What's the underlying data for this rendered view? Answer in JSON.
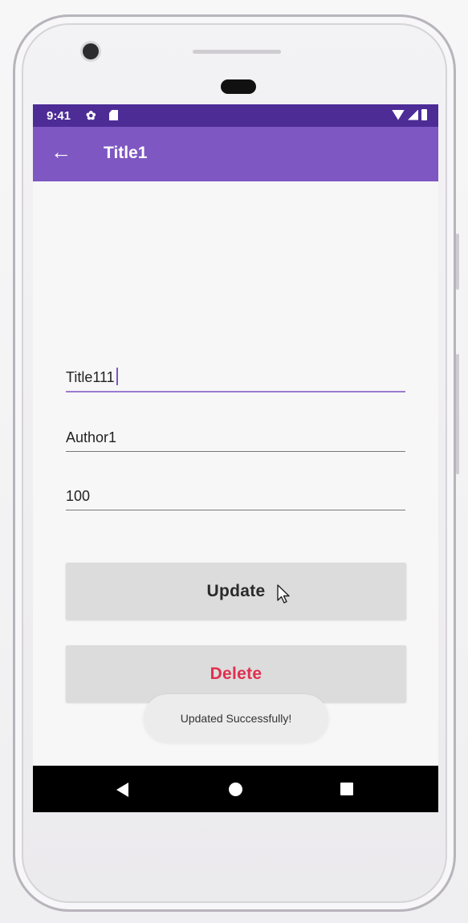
{
  "status_bar": {
    "time": "9:41",
    "icons": [
      "gear-icon",
      "sd-card-icon",
      "wifi-icon",
      "signal-icon",
      "battery-icon"
    ]
  },
  "app_bar": {
    "title": "Title1",
    "back_icon": "arrow-left-icon",
    "background": "#7e57c2",
    "status_background": "#4d2c96"
  },
  "form": {
    "title_value": "Title111",
    "author_value": "Author1",
    "price_value": "100"
  },
  "buttons": {
    "update_label": "Update",
    "delete_label": "Delete",
    "delete_color": "#e0304f"
  },
  "toast": {
    "message": "Updated Successfully!"
  },
  "nav": {
    "icons": [
      "nav-back-icon",
      "nav-home-icon",
      "nav-recents-icon"
    ]
  }
}
